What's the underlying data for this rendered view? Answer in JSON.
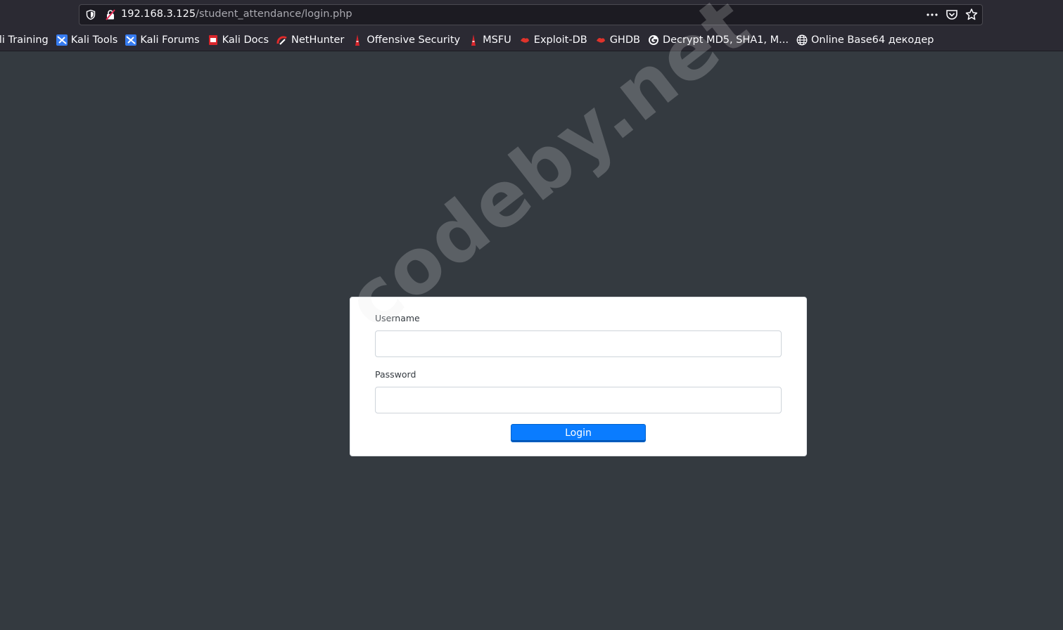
{
  "browser": {
    "url_host": "192.168.3.125",
    "url_path": "/student_attendance/login.php",
    "bookmarks": [
      {
        "label": "ali Training",
        "icon": "kali-icon"
      },
      {
        "label": "Kali Tools",
        "icon": "kali-icon"
      },
      {
        "label": "Kali Forums",
        "icon": "kali-icon"
      },
      {
        "label": "Kali Docs",
        "icon": "kali-docs-icon"
      },
      {
        "label": "NetHunter",
        "icon": "nethunter-icon"
      },
      {
        "label": "Offensive Security",
        "icon": "offsec-icon"
      },
      {
        "label": "MSFU",
        "icon": "offsec-icon"
      },
      {
        "label": "Exploit-DB",
        "icon": "exploitdb-icon"
      },
      {
        "label": "GHDB",
        "icon": "exploitdb-icon"
      },
      {
        "label": "Decrypt MD5, SHA1, M...",
        "icon": "md5-icon"
      },
      {
        "label": "Online Base64 декодер",
        "icon": "globe-icon"
      }
    ]
  },
  "login": {
    "username_label": "Username",
    "username_value": "",
    "password_label": "Password",
    "password_value": "",
    "button_label": "Login"
  },
  "watermark": "codeby.net",
  "colors": {
    "page_bg": "#343a40",
    "button": "#0a7cff"
  }
}
